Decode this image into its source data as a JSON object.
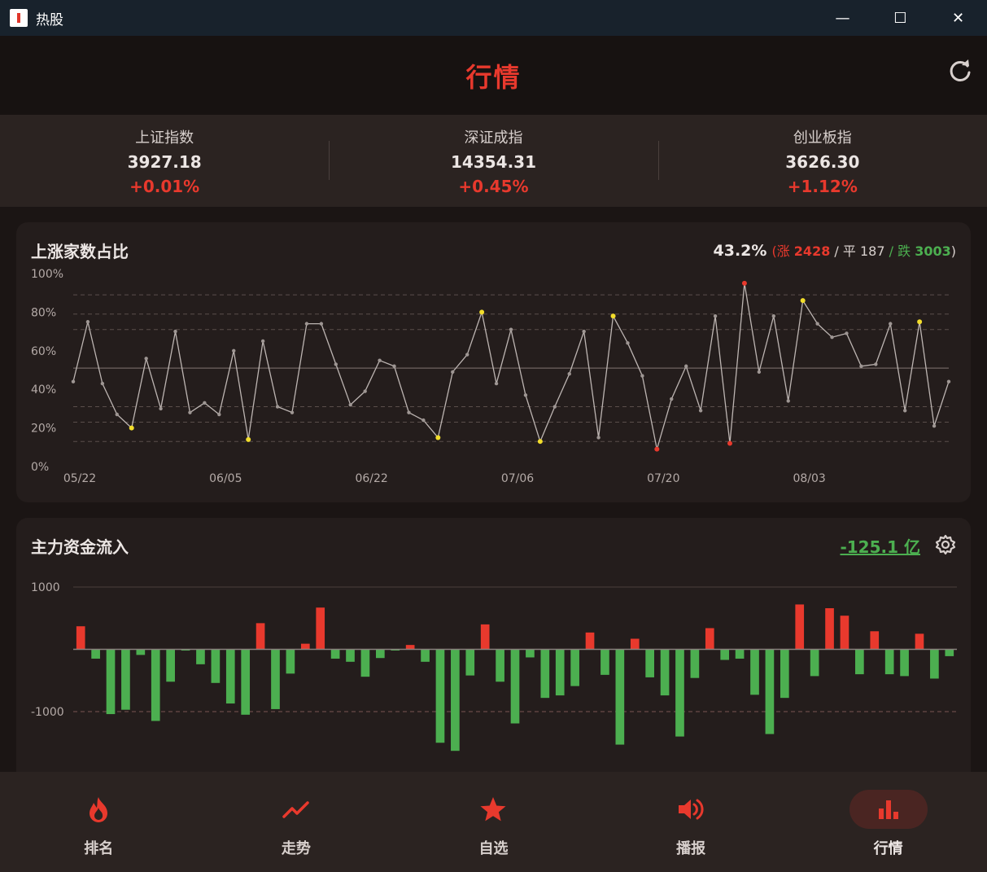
{
  "window": {
    "title": "热股",
    "minimize": "—",
    "maximize": "☐",
    "close": "✕"
  },
  "header": {
    "title": "行情"
  },
  "indices": [
    {
      "name": "上证指数",
      "value": "3927.18",
      "change": "+0.01%"
    },
    {
      "name": "深证成指",
      "value": "14354.31",
      "change": "+0.45%"
    },
    {
      "name": "创业板指",
      "value": "3626.30",
      "change": "+1.12%"
    }
  ],
  "advance": {
    "title": "上涨家数占比",
    "pct": "43.2%",
    "open_paren": "(",
    "up_label": "涨",
    "up_count": "2428",
    "sep1": " / ",
    "flat_label": "平",
    "flat_count": "187",
    "sep2": " / ",
    "down_label": "跌",
    "down_count": "3003",
    "close_paren": ")"
  },
  "flow": {
    "title": "主力资金流入",
    "total": "-125.1 亿"
  },
  "nav": [
    {
      "label": "排名",
      "icon": "flame-icon"
    },
    {
      "label": "走势",
      "icon": "trend-icon"
    },
    {
      "label": "自选",
      "icon": "star-icon"
    },
    {
      "label": "播报",
      "icon": "speaker-icon"
    },
    {
      "label": "行情",
      "icon": "bar-chart-icon",
      "active": true
    }
  ],
  "colors": {
    "up": "#e8392d",
    "down": "#4caf50",
    "accent": "#e8392d",
    "highlight_point": "#f2dd2b"
  },
  "chart_data": [
    {
      "type": "line",
      "y_tick_labels": [
        "0%",
        "20%",
        "40%",
        "60%",
        "80%",
        "100%"
      ],
      "ylim": [
        0,
        100
      ],
      "x_tick_labels": [
        "05/22",
        "06/05",
        "06/22",
        "07/06",
        "07/20",
        "08/03"
      ],
      "x_tick_index": [
        0,
        10,
        20,
        30,
        40,
        50
      ],
      "reference_line": 51,
      "dashed_levels": [
        13,
        23,
        31,
        71,
        79,
        89
      ],
      "values": [
        44,
        75,
        43,
        27,
        20,
        56,
        30,
        70,
        28,
        33,
        27,
        60,
        14,
        65,
        31,
        28,
        74,
        74,
        53,
        32,
        39,
        55,
        52,
        28,
        24,
        15,
        49,
        58,
        80,
        43,
        71,
        37,
        13,
        31,
        48,
        70,
        15,
        78,
        64,
        47,
        9,
        35,
        52,
        29,
        78,
        12,
        95,
        49,
        78,
        34,
        86,
        74,
        67,
        69,
        52,
        53,
        74,
        29,
        75,
        21,
        44
      ],
      "highlight_low": [
        4,
        12,
        25,
        32,
        37,
        58
      ],
      "highlight_high": [
        28,
        50
      ],
      "extreme_low": [
        40,
        45
      ],
      "extreme_high": [
        46
      ]
    },
    {
      "type": "bar",
      "y_tick_labels": [
        "1000",
        "-1000"
      ],
      "ylim": [
        -1700,
        1100
      ],
      "dashed_levels": [
        1000,
        -1000
      ],
      "values": [
        370,
        -150,
        -1040,
        -970,
        -90,
        -1150,
        -520,
        -20,
        -240,
        -540,
        -870,
        -1050,
        420,
        -960,
        -390,
        90,
        670,
        -150,
        -200,
        -440,
        -140,
        -10,
        70,
        -200,
        -1500,
        -1630,
        -420,
        400,
        -520,
        -1190,
        -130,
        -780,
        -740,
        -590,
        270,
        -410,
        -1530,
        170,
        -450,
        -740,
        -1400,
        -460,
        340,
        -170,
        -150,
        -730,
        -1360,
        -780,
        720,
        -430,
        660,
        540,
        -400,
        290,
        -400,
        -430,
        250,
        -470,
        -110
      ],
      "up_color": "#e8392d",
      "down_color": "#4caf50"
    }
  ]
}
